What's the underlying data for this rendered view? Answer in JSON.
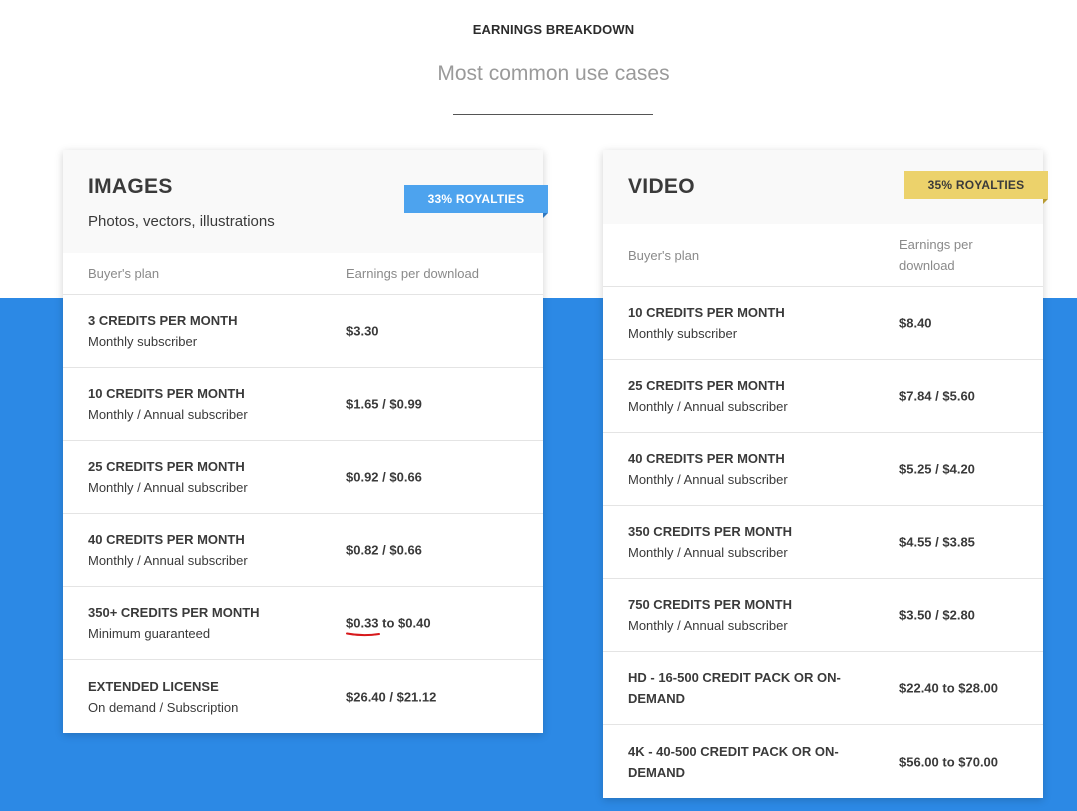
{
  "header": {
    "eyebrow": "EARNINGS BREAKDOWN",
    "subtitle": "Most common use cases"
  },
  "colors": {
    "background_band": "#2c89e5",
    "images_ribbon": "#4da3ee",
    "video_ribbon": "#ecd26b",
    "annotation_underline": "#d7191c"
  },
  "images": {
    "title": "IMAGES",
    "subtitle": "Photos, vectors, illustrations",
    "ribbon": "33% ROYALTIES",
    "col_plan": "Buyer's plan",
    "col_earnings": "Earnings per download",
    "rows": [
      {
        "plan": "3 CREDITS PER MONTH",
        "type": "Monthly subscriber",
        "earnings": "$3.30"
      },
      {
        "plan": "10 CREDITS PER MONTH",
        "type": "Monthly / Annual subscriber",
        "earnings": "$1.65 / $0.99"
      },
      {
        "plan": "25 CREDITS PER MONTH",
        "type": "Monthly / Annual subscriber",
        "earnings": "$0.92 / $0.66"
      },
      {
        "plan": "40 CREDITS PER MONTH",
        "type": "Monthly / Annual subscriber",
        "earnings": "$0.82 / $0.66"
      },
      {
        "plan": "350+ CREDITS PER MONTH",
        "type": "Minimum guaranteed",
        "earnings": "$0.33 to $0.40"
      },
      {
        "plan": "EXTENDED LICENSE",
        "type": "On demand / Subscription",
        "earnings": "$26.40 / $21.12"
      }
    ]
  },
  "video": {
    "title": "VIDEO",
    "ribbon": "35% ROYALTIES",
    "col_plan": "Buyer's plan",
    "col_earnings_line1": "Earnings per",
    "col_earnings_line2": "download",
    "rows": [
      {
        "plan": "10 CREDITS PER MONTH",
        "type": "Monthly subscriber",
        "earnings": "$8.40"
      },
      {
        "plan": "25 CREDITS PER MONTH",
        "type": "Monthly / Annual subscriber",
        "earnings": "$7.84 / $5.60"
      },
      {
        "plan": "40 CREDITS PER MONTH",
        "type": "Monthly / Annual subscriber",
        "earnings": "$5.25 / $4.20"
      },
      {
        "plan": "350 CREDITS PER MONTH",
        "type": "Monthly / Annual subscriber",
        "earnings": "$4.55 / $3.85"
      },
      {
        "plan": "750 CREDITS PER MONTH",
        "type": "Monthly / Annual subscriber",
        "earnings": "$3.50 / $2.80"
      },
      {
        "plan_line1": "HD - 16-500 CREDIT PACK OR ON-",
        "plan_line2": "DEMAND",
        "earnings": "$22.40 to $28.00"
      },
      {
        "plan_line1": "4K - 40-500 CREDIT PACK OR ON-",
        "plan_line2": "DEMAND",
        "earnings": "$56.00 to $70.00"
      }
    ]
  }
}
